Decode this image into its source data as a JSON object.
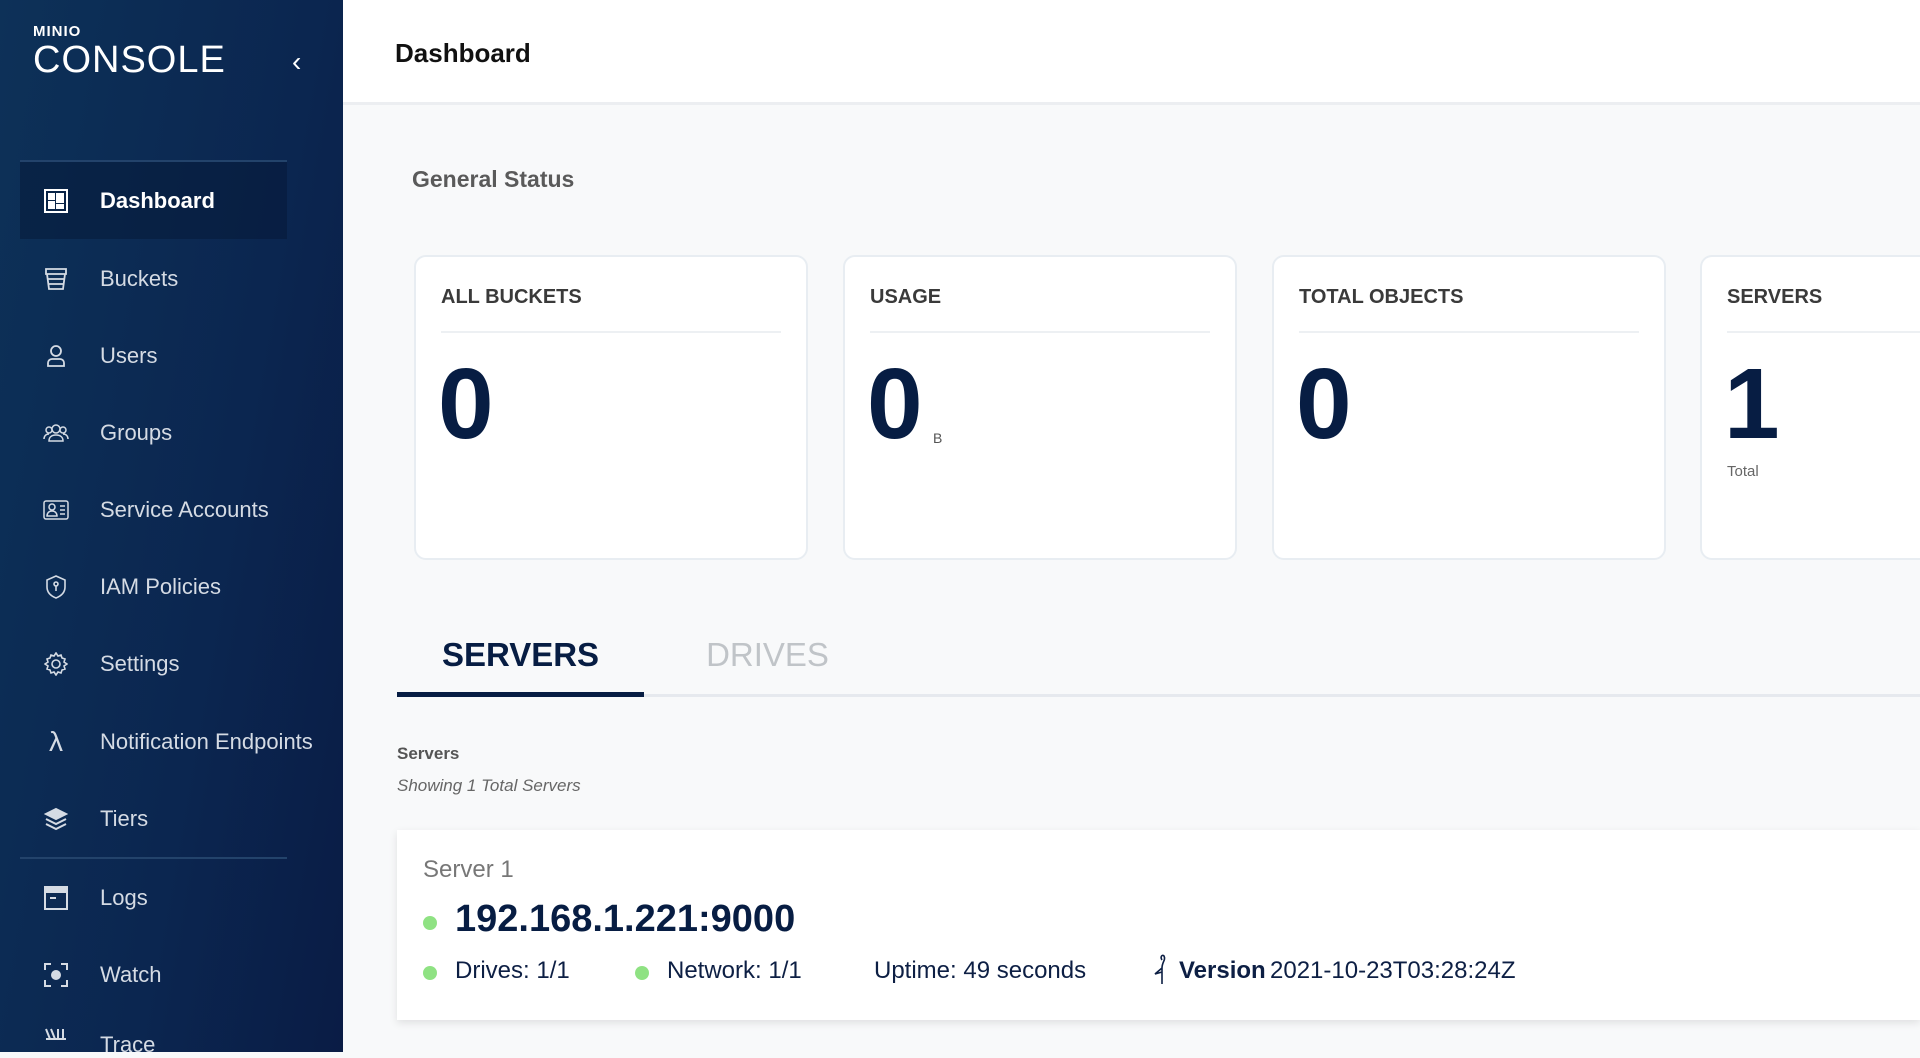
{
  "sidebar": {
    "logo_top": "MINIO",
    "logo_main": "CONSOLE",
    "collapse": "‹",
    "items": [
      {
        "label": "Dashboard",
        "icon": "dashboard-icon"
      },
      {
        "label": "Buckets",
        "icon": "bucket-icon"
      },
      {
        "label": "Users",
        "icon": "user-icon"
      },
      {
        "label": "Groups",
        "icon": "groups-icon"
      },
      {
        "label": "Service Accounts",
        "icon": "service-account-icon"
      },
      {
        "label": "IAM Policies",
        "icon": "shield-icon"
      },
      {
        "label": "Settings",
        "icon": "gear-icon"
      },
      {
        "label": "Notification Endpoints",
        "icon": "lambda-icon"
      },
      {
        "label": "Tiers",
        "icon": "layers-icon"
      },
      {
        "label": "Logs",
        "icon": "logs-icon"
      },
      {
        "label": "Watch",
        "icon": "watch-icon"
      },
      {
        "label": "Trace",
        "icon": "trace-icon"
      }
    ]
  },
  "header": {
    "title": "Dashboard"
  },
  "general_status": "General Status",
  "cards": [
    {
      "title": "ALL BUCKETS",
      "value": "0"
    },
    {
      "title": "USAGE",
      "value": "0",
      "unit": "B"
    },
    {
      "title": "TOTAL OBJECTS",
      "value": "0"
    },
    {
      "title": "SERVERS",
      "value": "1",
      "sub": "Total"
    }
  ],
  "tabs": [
    "SERVERS",
    "DRIVES"
  ],
  "servers_section": {
    "title": "Servers",
    "subtitle": "Showing 1 Total Servers"
  },
  "server": {
    "name": "Server 1",
    "endpoint": "192.168.1.221:9000",
    "drives": "Drives: 1/1",
    "network": "Network: 1/1",
    "uptime": "Uptime: 49 seconds",
    "version_label": "Version",
    "version": "2021-10-23T03:28:24Z"
  },
  "colors": {
    "online": "#8fe283",
    "navy": "#071d43"
  }
}
